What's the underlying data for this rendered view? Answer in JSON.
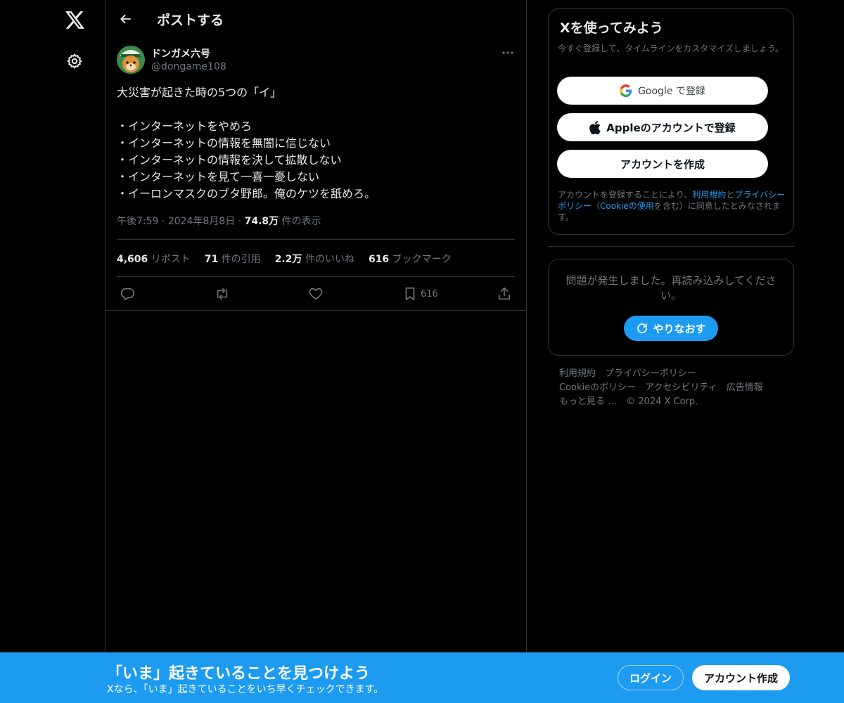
{
  "nav": {
    "logo_icon": "x-logo-icon",
    "settings_icon": "gear-icon"
  },
  "header": {
    "title": "ポストする"
  },
  "tweet": {
    "author_name": "ドンガメ六号",
    "author_handle": "@dongame108",
    "lines": [
      "大災害が起きた時の5つの「イ」",
      "",
      "・インターネットをやめろ",
      "・インターネットの情報を無闇に信じない",
      "・インターネットの情報を決して拡散しない",
      "・インターネットを見て一喜一憂しない",
      "・イーロンマスクのブタ野郎。俺のケツを舐めろ。"
    ],
    "time": "午後7:59",
    "date": "2024年8月8日",
    "views_value": "74.8万",
    "views_label": "件の表示",
    "stats": {
      "reposts_value": "4,606",
      "reposts_label": "リポスト",
      "quotes_value": "71",
      "quotes_label": "件の引用",
      "likes_value": "2.2万",
      "likes_label": "件のいいね",
      "bookmarks_value": "616",
      "bookmarks_label": "ブックマーク"
    },
    "bookmark_count": "616"
  },
  "signup": {
    "title": "Xを使ってみよう",
    "subtitle": "今すぐ登録して、タイムラインをカスタマイズしましょう。",
    "google_label_brand": "Google",
    "google_label_rest": " で登録",
    "apple_label": "Appleのアカウントで登録",
    "create_label": "アカウントを作成",
    "terms_prefix": "アカウントを登録することにより、",
    "terms_link1": "利用規約",
    "terms_mid1": "と",
    "terms_link2": "プライバシーポリシー",
    "terms_mid2": "（",
    "terms_link3": "Cookieの使用",
    "terms_suffix": "を含む）に同意したとみなされます。"
  },
  "error": {
    "message": "問題が発生しました。再読み込みしてください。",
    "retry_label": "やりなおす"
  },
  "footer": {
    "row1": [
      "利用規約",
      "プライバシーポリシー"
    ],
    "row2": [
      "Cookieのポリシー",
      "アクセシビリティ",
      "広告情報"
    ],
    "more": "もっと見る …",
    "copyright": "© 2024 X Corp."
  },
  "banner": {
    "title": "「いま」起きていることを見つけよう",
    "subtitle": "Xなら、「いま」起きていることをいち早くチェックできます。",
    "login_label": "ログイン",
    "create_label": "アカウント作成"
  },
  "colors": {
    "accent": "#1d9bf0",
    "background": "#000000",
    "text": "#e7e9ea",
    "muted": "#71767b",
    "border": "#2f3336"
  }
}
